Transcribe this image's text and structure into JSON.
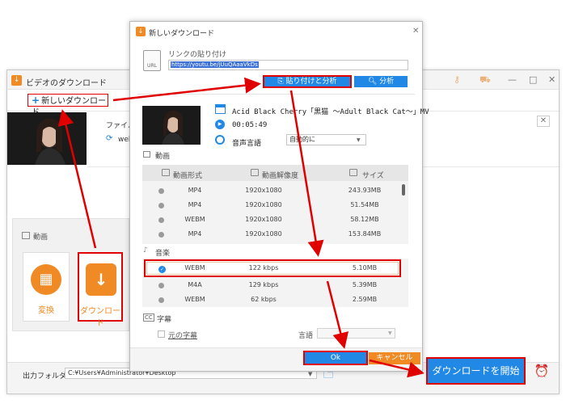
{
  "main_window": {
    "title": "ビデオのダウンロード",
    "new_download_label": "新しいダウンロード",
    "file_name_label": "ファイル名",
    "format_text": "web",
    "video_section_label": "動画",
    "convert_label": "変換",
    "download_label": "ダウンロード",
    "output_folder_label": "出力フォルダ：",
    "output_path": "C:¥Users¥Administrator¥Desktop",
    "start_download_label": "ダウンロードを開始"
  },
  "dialog": {
    "title": "新しいダウンロード",
    "paste_link_label": "リンクの貼り付け",
    "url_value": "https://youtu.be/jUuQAaaVkDs",
    "url_icon_text": "URL",
    "paste_analyze_label": "貼り付けと分析",
    "analyze_label": "分析",
    "video_title": "Acid Black Cherry「黒猫 ～Adult Black Cat～」MV",
    "duration": "00:05:49",
    "audio_lang_label": "音声言語",
    "audio_lang_value": "自動的に",
    "video_section_label": "動画",
    "columns": {
      "format": "動画形式",
      "resolution": "動画解像度",
      "size": "サイズ"
    },
    "video_rows": [
      {
        "format": "MP4",
        "resolution": "1920x1080",
        "size": "243.93MB"
      },
      {
        "format": "MP4",
        "resolution": "1920x1080",
        "size": "51.54MB"
      },
      {
        "format": "WEBM",
        "resolution": "1920x1080",
        "size": "58.12MB"
      },
      {
        "format": "MP4",
        "resolution": "1920x1080",
        "size": "153.84MB"
      }
    ],
    "audio_section_label": "音楽",
    "audio_rows": [
      {
        "format": "WEBM",
        "bitrate": "122 kbps",
        "size": "5.10MB",
        "selected": true
      },
      {
        "format": "M4A",
        "bitrate": "129 kbps",
        "size": "5.39MB",
        "selected": false
      },
      {
        "format": "WEBM",
        "bitrate": "62 kbps",
        "size": "2.59MB",
        "selected": false
      }
    ],
    "subtitle_section_label": "字幕",
    "original_subtitle_label": "元の字幕",
    "subtitle_lang_label": "言語",
    "ok_label": "Ok",
    "cancel_label": "キャンセル"
  },
  "colors": {
    "accent_blue": "#2188e6",
    "accent_orange": "#f08a24",
    "highlight_red": "#e00000"
  }
}
